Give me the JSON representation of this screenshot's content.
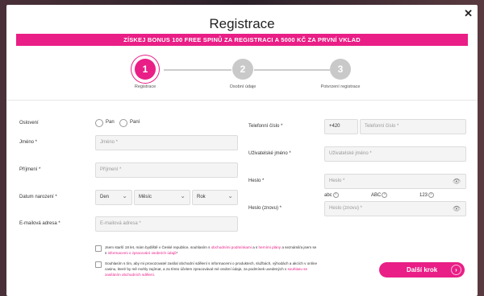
{
  "modal": {
    "title": "Registrace",
    "banner": "ZÍSKEJ BONUS 100 FREE SPINŮ ZA REGISTRACI A 5000 KČ ZA PRVNÍ VKLAD"
  },
  "steps": [
    {
      "number": "1",
      "label": "Registrace"
    },
    {
      "number": "2",
      "label": "Osobní údaje"
    },
    {
      "number": "3",
      "label": "Potvrzení registrace"
    }
  ],
  "form": {
    "salutation_label": "Oslovení",
    "salutation_options": [
      "Pan",
      "Paní"
    ],
    "first_name_label": "Jméno *",
    "first_name_placeholder": "Jméno *",
    "last_name_label": "Příjmení *",
    "last_name_placeholder": "Příjmení *",
    "birth_label": "Datum narození *",
    "birth_day": "Den",
    "birth_month": "Měsíc",
    "birth_year": "Rok",
    "email_label": "E-mailová adresa *",
    "email_placeholder": "E-mailová adresa *",
    "phone_label": "Telefonní číslo *",
    "phone_prefix": "+420",
    "phone_placeholder": "Telefonní číslo *",
    "username_label": "Uživatelské jméno *",
    "username_placeholder": "Uživatelské jméno *",
    "password_label": "Heslo *",
    "password_placeholder": "Heslo *",
    "password_hints": [
      "abc",
      "ABC",
      "123"
    ],
    "password_again_label": "Heslo (znovu) *",
    "password_again_placeholder": "Heslo (znovu) *"
  },
  "consent": {
    "age_text_a": "Jsem starší 18 let, mám bydliště v České republice, souhlasím s ",
    "age_link_1": "obchodními podmínkami",
    "age_text_b": " a s ",
    "age_link_2": "herními plány",
    "age_text_c": " a seznámil/a jsem se s ",
    "age_link_3": "informacemi o zpracování osobních údajů",
    "age_text_d": "*",
    "marketing_text_a": "Souhlasím s tím, aby mi provozovatel zasílal obchodní sdělení s informacemi o produktech, službách, výhodách a akcích v online casinu, které by mě mohly zajímat, a za tímto účelem zpracovával mé osobní údaje, za podmínek uvedených v ",
    "marketing_link": "souhlasu se zasíláním obchodních sdělení",
    "marketing_text_b": "."
  },
  "actions": {
    "next_label": "Další krok",
    "next_arrow": "›",
    "close_label": "✕"
  },
  "icons": {
    "eye": "👁",
    "clear": "×"
  },
  "colors": {
    "accent": "#e91e86",
    "inactive_step": "#c9c9c9"
  }
}
